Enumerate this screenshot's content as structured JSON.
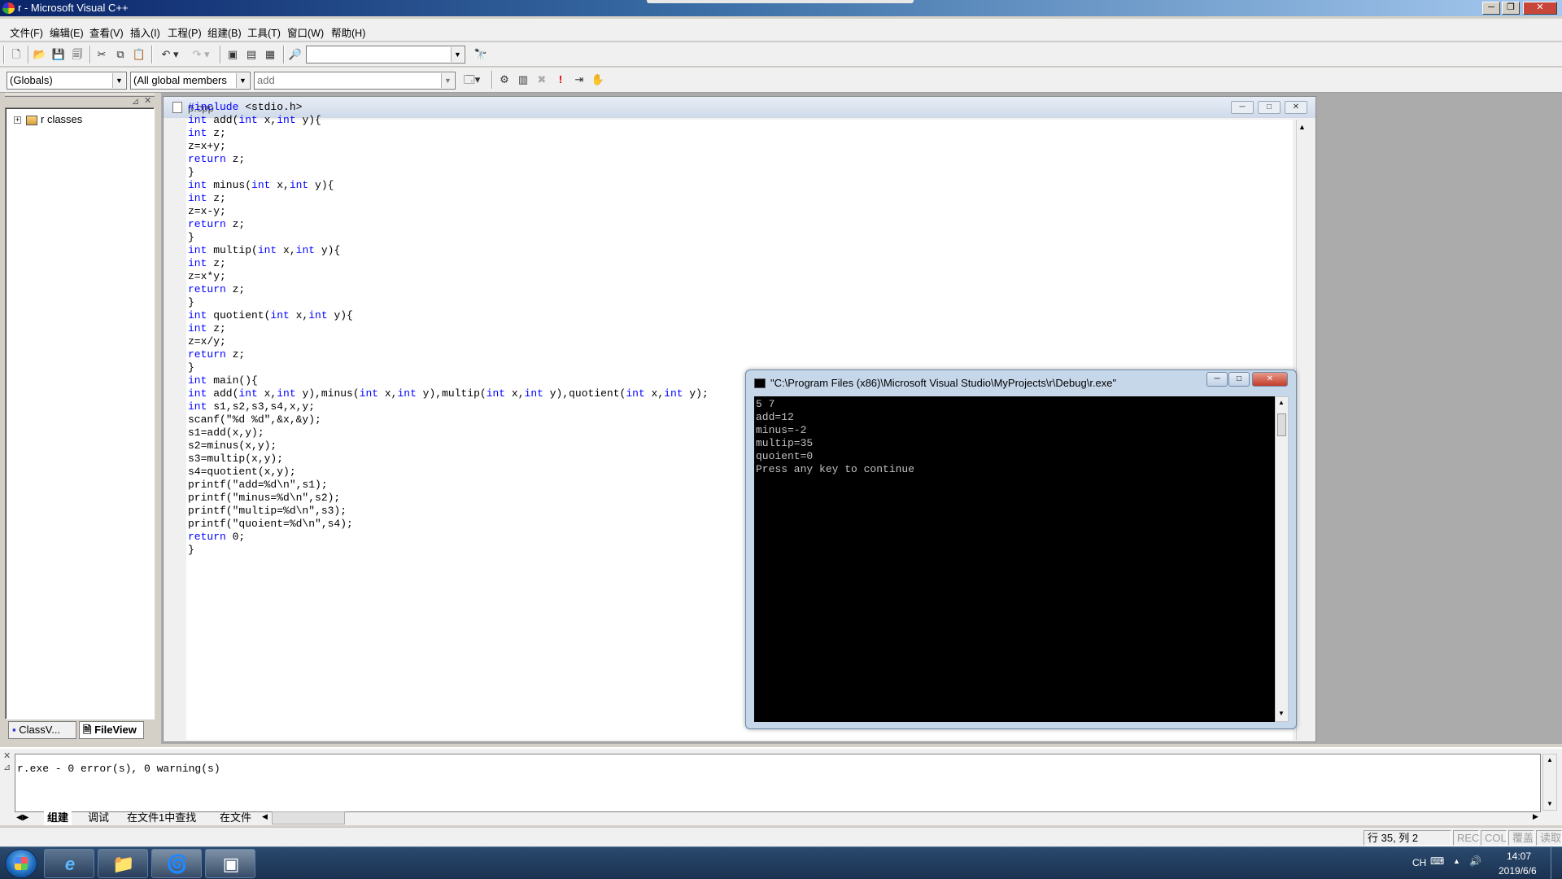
{
  "window": {
    "title": "r - Microsoft Visual C++",
    "buttons": {
      "minimize": "─",
      "maximize": "❐",
      "close": "✕"
    }
  },
  "menu": [
    "文件(F)",
    "编辑(E)",
    "查看(V)",
    "插入(I)",
    "工程(P)",
    "组建(B)",
    "工具(T)",
    "窗口(W)",
    "帮助(H)"
  ],
  "toolbar2": {
    "scope": "(Globals)",
    "members": "(All global members",
    "function": "add"
  },
  "workspace": {
    "tree_root": "r classes",
    "tabs": [
      "ClassV...",
      "FileView"
    ]
  },
  "document": {
    "filename": "p.cpp",
    "code": [
      [
        [
          "kw",
          "#include"
        ],
        [
          "t",
          " <stdio.h>"
        ]
      ],
      [
        [
          "kw",
          "int"
        ],
        [
          "t",
          " add("
        ],
        [
          "kw",
          "int"
        ],
        [
          "t",
          " x,"
        ],
        [
          "kw",
          "int"
        ],
        [
          "t",
          " y){"
        ]
      ],
      [
        [
          "kw",
          "int"
        ],
        [
          "t",
          " z;"
        ]
      ],
      [
        [
          "t",
          "z=x+y;"
        ]
      ],
      [
        [
          "kw",
          "return"
        ],
        [
          "t",
          " z;"
        ]
      ],
      [
        [
          "t",
          "}"
        ]
      ],
      [
        [
          "kw",
          "int"
        ],
        [
          "t",
          " minus("
        ],
        [
          "kw",
          "int"
        ],
        [
          "t",
          " x,"
        ],
        [
          "kw",
          "int"
        ],
        [
          "t",
          " y){"
        ]
      ],
      [
        [
          "kw",
          "int"
        ],
        [
          "t",
          " z;"
        ]
      ],
      [
        [
          "t",
          "z=x-y;"
        ]
      ],
      [
        [
          "kw",
          "return"
        ],
        [
          "t",
          " z;"
        ]
      ],
      [
        [
          "t",
          "}"
        ]
      ],
      [
        [
          "kw",
          "int"
        ],
        [
          "t",
          " multip("
        ],
        [
          "kw",
          "int"
        ],
        [
          "t",
          " x,"
        ],
        [
          "kw",
          "int"
        ],
        [
          "t",
          " y){"
        ]
      ],
      [
        [
          "kw",
          "int"
        ],
        [
          "t",
          " z;"
        ]
      ],
      [
        [
          "t",
          "z=x*y;"
        ]
      ],
      [
        [
          "kw",
          "return"
        ],
        [
          "t",
          " z;"
        ]
      ],
      [
        [
          "t",
          "}"
        ]
      ],
      [
        [
          "kw",
          "int"
        ],
        [
          "t",
          " quotient("
        ],
        [
          "kw",
          "int"
        ],
        [
          "t",
          " x,"
        ],
        [
          "kw",
          "int"
        ],
        [
          "t",
          " y){"
        ]
      ],
      [
        [
          "kw",
          "int"
        ],
        [
          "t",
          " z;"
        ]
      ],
      [
        [
          "t",
          "z=x/y;"
        ]
      ],
      [
        [
          "kw",
          "return"
        ],
        [
          "t",
          " z;"
        ]
      ],
      [
        [
          "t",
          "}"
        ]
      ],
      [
        [
          "kw",
          "int"
        ],
        [
          "t",
          " main(){"
        ]
      ],
      [
        [
          "kw",
          "int"
        ],
        [
          "t",
          " add("
        ],
        [
          "kw",
          "int"
        ],
        [
          "t",
          " x,"
        ],
        [
          "kw",
          "int"
        ],
        [
          "t",
          " y),minus("
        ],
        [
          "kw",
          "int"
        ],
        [
          "t",
          " x,"
        ],
        [
          "kw",
          "int"
        ],
        [
          "t",
          " y),multip("
        ],
        [
          "kw",
          "int"
        ],
        [
          "t",
          " x,"
        ],
        [
          "kw",
          "int"
        ],
        [
          "t",
          " y),quotient("
        ],
        [
          "kw",
          "int"
        ],
        [
          "t",
          " x,"
        ],
        [
          "kw",
          "int"
        ],
        [
          "t",
          " y);"
        ]
      ],
      [
        [
          "kw",
          "int"
        ],
        [
          "t",
          " s1,s2,s3,s4,x,y;"
        ]
      ],
      [
        [
          "t",
          "scanf(\"%d %d\",&x,&y);"
        ]
      ],
      [
        [
          "t",
          "s1=add(x,y);"
        ]
      ],
      [
        [
          "t",
          "s2=minus(x,y);"
        ]
      ],
      [
        [
          "t",
          "s3=multip(x,y);"
        ]
      ],
      [
        [
          "t",
          "s4=quotient(x,y);"
        ]
      ],
      [
        [
          "t",
          "printf(\"add=%d\\n\",s1);"
        ]
      ],
      [
        [
          "t",
          "printf(\"minus=%d\\n\",s2);"
        ]
      ],
      [
        [
          "t",
          "printf(\"multip=%d\\n\",s3);"
        ]
      ],
      [
        [
          "t",
          "printf(\"quoient=%d\\n\",s4);"
        ]
      ],
      [
        [
          "kw",
          "return"
        ],
        [
          "t",
          " 0;"
        ]
      ],
      [
        [
          "t",
          "}"
        ]
      ]
    ]
  },
  "console": {
    "title": "\"C:\\Program Files (x86)\\Microsoft Visual Studio\\MyProjects\\r\\Debug\\r.exe\"",
    "lines": [
      "5 7",
      "add=12",
      "minus=-2",
      "multip=35",
      "quoient=0",
      "Press any key to continue"
    ]
  },
  "output": {
    "text": "r.exe - 0 error(s), 0 warning(s)",
    "tabs": [
      "组建",
      "调试",
      "在文件1中查找",
      "在文件"
    ]
  },
  "statusbar": {
    "position": "行 35, 列 2",
    "rec": "REC",
    "col": "COL",
    "ovr": "覆盖",
    "read": "读取"
  },
  "taskbar": {
    "lang": "CH",
    "time": "14:07",
    "date": "2019/6/6"
  }
}
